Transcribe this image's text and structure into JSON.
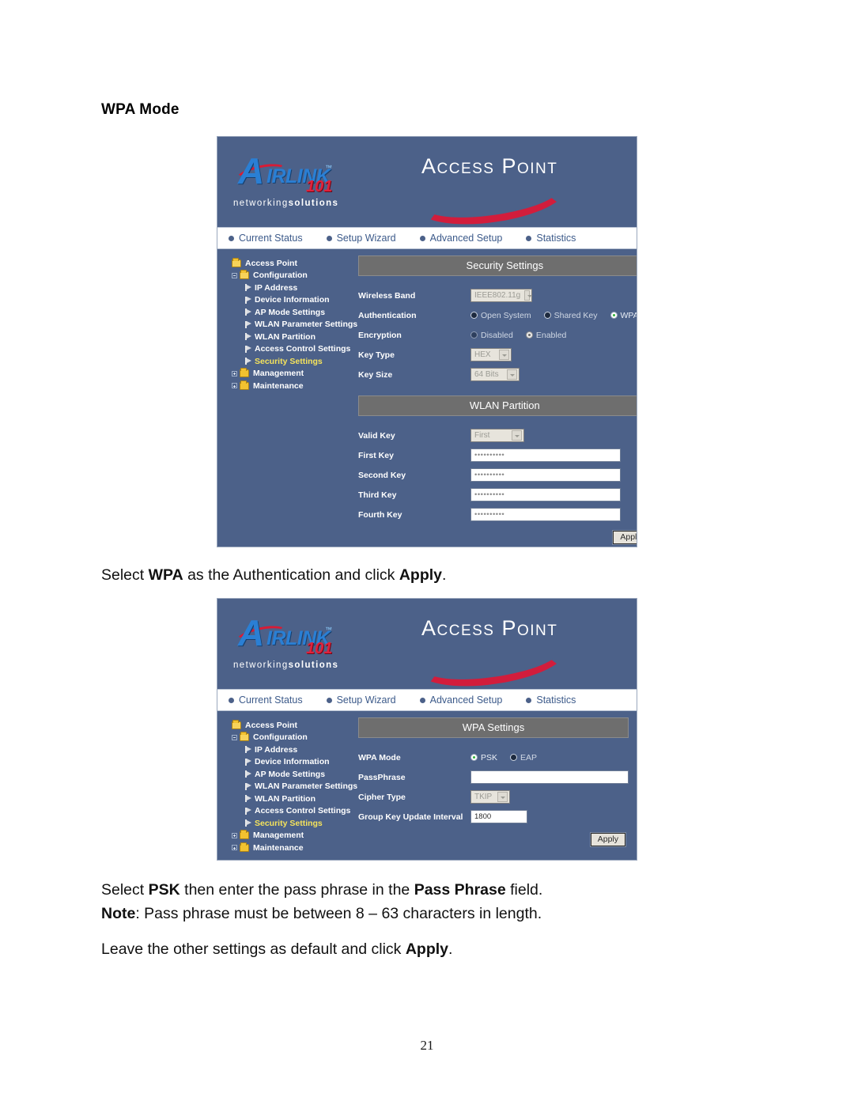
{
  "document": {
    "heading": "WPA Mode",
    "paragraph_1": {
      "prefix": "Select ",
      "bold_1": "WPA",
      "middle": " as the Authentication and click ",
      "bold_2": "Apply",
      "suffix": "."
    },
    "paragraph_2_line_1": {
      "prefix": "Select ",
      "bold_1": "PSK",
      "middle": " then enter the pass phrase in the ",
      "bold_2": "Pass Phrase",
      "suffix": " field."
    },
    "paragraph_2_line_2": {
      "bold_1": "Note",
      "rest": ": Pass phrase must be between 8 – 63 characters in length."
    },
    "paragraph_3": {
      "prefix": "Leave the other settings as default and click ",
      "bold_1": "Apply",
      "suffix": "."
    },
    "page_number": "21"
  },
  "brand": {
    "logo_letter": "A",
    "logo_rest": "IRLINK",
    "logo_tm": "™",
    "logo_101": "101",
    "tagline_light": "networking",
    "tagline_bold": "solutions",
    "product_title": "Access Point",
    "accent_red": "#d21d3c",
    "accent_blue": "#2a7fd4",
    "panel_blue": "#4c6189",
    "section_gray": "#6e6e6e",
    "active_item_yellow": "#f5e35c"
  },
  "navbar": {
    "items": [
      {
        "label": "Current Status"
      },
      {
        "label": "Setup Wizard"
      },
      {
        "label": "Advanced Setup"
      },
      {
        "label": "Statistics"
      }
    ]
  },
  "sidebar": {
    "items": [
      {
        "label": "Access Point",
        "level": 1,
        "type": "folder-open",
        "toggle": "none",
        "active": false
      },
      {
        "label": "Configuration",
        "level": 2,
        "type": "folder-open",
        "toggle": "minus",
        "active": false
      },
      {
        "label": "IP Address",
        "level": 3,
        "type": "leaf",
        "toggle": "none",
        "active": false
      },
      {
        "label": "Device Information",
        "level": 3,
        "type": "leaf",
        "toggle": "none",
        "active": false
      },
      {
        "label": "AP Mode Settings",
        "level": 3,
        "type": "leaf",
        "toggle": "none",
        "active": false
      },
      {
        "label": "WLAN  Parameter Settings",
        "level": 3,
        "type": "leaf",
        "toggle": "none",
        "active": false
      },
      {
        "label": "WLAN  Partition",
        "level": 3,
        "type": "leaf",
        "toggle": "none",
        "active": false
      },
      {
        "label": "Access Control Settings",
        "level": 3,
        "type": "leaf",
        "toggle": "none",
        "active": false
      },
      {
        "label": "Security Settings",
        "level": 3,
        "type": "leaf",
        "toggle": "none",
        "active": true
      },
      {
        "label": "Management",
        "level": 2,
        "type": "folder",
        "toggle": "plus",
        "active": false
      },
      {
        "label": "Maintenance",
        "level": 2,
        "type": "folder",
        "toggle": "plus",
        "active": false
      }
    ]
  },
  "screenshot_1": {
    "security_settings": {
      "section_title": "Security Settings",
      "wireless_band": {
        "label": "Wireless Band",
        "value": "IEEE802.11g"
      },
      "authentication": {
        "label": "Authentication",
        "options": [
          {
            "label": "Open System",
            "selected": false
          },
          {
            "label": "Shared Key",
            "selected": false
          },
          {
            "label": "WPA",
            "selected": true
          }
        ]
      },
      "encryption": {
        "label": "Encryption",
        "options": [
          {
            "label": "Disabled",
            "selected": false
          },
          {
            "label": "Enabled",
            "selected": true
          }
        ]
      },
      "key_type": {
        "label": "Key Type",
        "value": "HEX"
      },
      "key_size": {
        "label": "Key Size",
        "value": "64 Bits"
      }
    },
    "wlan_partition": {
      "section_title": "WLAN Partition",
      "valid_key": {
        "label": "Valid Key",
        "value": "First"
      },
      "keys": [
        {
          "label": "First Key",
          "value": "••••••••••"
        },
        {
          "label": "Second Key",
          "value": "••••••••••"
        },
        {
          "label": "Third Key",
          "value": "••••••••••"
        },
        {
          "label": "Fourth Key",
          "value": "••••••••••"
        }
      ],
      "apply_label": "Apply"
    }
  },
  "screenshot_2": {
    "wpa_settings": {
      "section_title": "WPA Settings",
      "wpa_mode": {
        "label": "WPA Mode",
        "options": [
          {
            "label": "PSK",
            "selected": true
          },
          {
            "label": "EAP",
            "selected": false
          }
        ]
      },
      "passphrase": {
        "label": "PassPhrase",
        "value": ""
      },
      "cipher_type": {
        "label": "Cipher Type",
        "value": "TKIP"
      },
      "group_key_update_interval": {
        "label": "Group Key Update Interval",
        "value": "1800"
      },
      "apply_label": "Apply"
    }
  }
}
